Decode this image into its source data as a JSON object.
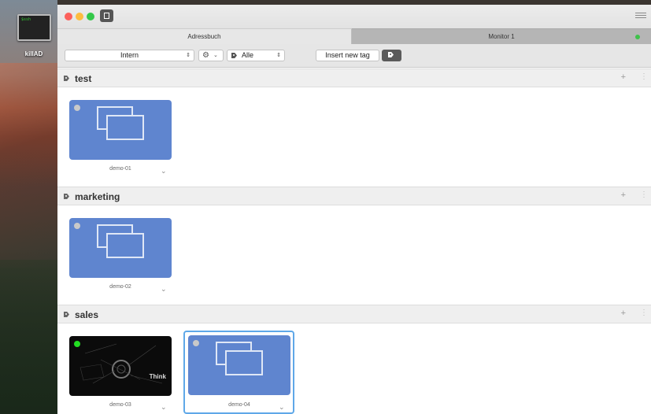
{
  "desktop": {
    "icon_prompt": "$ssh",
    "icon_label": "killAD"
  },
  "window": {
    "tabs": [
      {
        "label": "Adressbuch"
      },
      {
        "label": "Monitor 1"
      }
    ],
    "monitor_status_color": "#3fc24b"
  },
  "toolbar": {
    "group_select": "Intern",
    "tag_filter": "Alle",
    "insert_button": "Insert new tag"
  },
  "sections": [
    {
      "name": "test",
      "add": "+",
      "more": "⋮",
      "tiles": [
        {
          "label": "demo-01",
          "status": "offline",
          "preview": "placeholder"
        }
      ]
    },
    {
      "name": "marketing",
      "add": "+",
      "more": "⋮",
      "tiles": [
        {
          "label": "demo-02",
          "status": "offline",
          "preview": "placeholder"
        }
      ]
    },
    {
      "name": "sales",
      "add": "+",
      "more": "⋮",
      "tiles": [
        {
          "label": "demo-03",
          "status": "online",
          "preview": "screenshot",
          "preview_text": "Think"
        },
        {
          "label": "demo-04",
          "status": "offline",
          "preview": "placeholder",
          "selected": true
        }
      ]
    }
  ],
  "colors": {
    "tile_blue": "#5f85cf",
    "online_green": "#22dd22",
    "selection_blue": "#5fa8e8"
  }
}
